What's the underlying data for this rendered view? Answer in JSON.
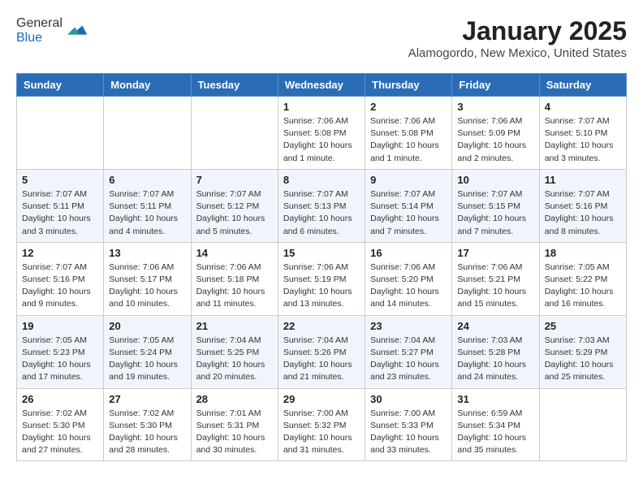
{
  "header": {
    "logo_line1": "General",
    "logo_line2": "Blue",
    "month": "January 2025",
    "location": "Alamogordo, New Mexico, United States"
  },
  "weekdays": [
    "Sunday",
    "Monday",
    "Tuesday",
    "Wednesday",
    "Thursday",
    "Friday",
    "Saturday"
  ],
  "weeks": [
    [
      {
        "day": "",
        "info": ""
      },
      {
        "day": "",
        "info": ""
      },
      {
        "day": "",
        "info": ""
      },
      {
        "day": "1",
        "info": "Sunrise: 7:06 AM\nSunset: 5:08 PM\nDaylight: 10 hours\nand 1 minute."
      },
      {
        "day": "2",
        "info": "Sunrise: 7:06 AM\nSunset: 5:08 PM\nDaylight: 10 hours\nand 1 minute."
      },
      {
        "day": "3",
        "info": "Sunrise: 7:06 AM\nSunset: 5:09 PM\nDaylight: 10 hours\nand 2 minutes."
      },
      {
        "day": "4",
        "info": "Sunrise: 7:07 AM\nSunset: 5:10 PM\nDaylight: 10 hours\nand 3 minutes."
      }
    ],
    [
      {
        "day": "5",
        "info": "Sunrise: 7:07 AM\nSunset: 5:11 PM\nDaylight: 10 hours\nand 3 minutes."
      },
      {
        "day": "6",
        "info": "Sunrise: 7:07 AM\nSunset: 5:11 PM\nDaylight: 10 hours\nand 4 minutes."
      },
      {
        "day": "7",
        "info": "Sunrise: 7:07 AM\nSunset: 5:12 PM\nDaylight: 10 hours\nand 5 minutes."
      },
      {
        "day": "8",
        "info": "Sunrise: 7:07 AM\nSunset: 5:13 PM\nDaylight: 10 hours\nand 6 minutes."
      },
      {
        "day": "9",
        "info": "Sunrise: 7:07 AM\nSunset: 5:14 PM\nDaylight: 10 hours\nand 7 minutes."
      },
      {
        "day": "10",
        "info": "Sunrise: 7:07 AM\nSunset: 5:15 PM\nDaylight: 10 hours\nand 7 minutes."
      },
      {
        "day": "11",
        "info": "Sunrise: 7:07 AM\nSunset: 5:16 PM\nDaylight: 10 hours\nand 8 minutes."
      }
    ],
    [
      {
        "day": "12",
        "info": "Sunrise: 7:07 AM\nSunset: 5:16 PM\nDaylight: 10 hours\nand 9 minutes."
      },
      {
        "day": "13",
        "info": "Sunrise: 7:06 AM\nSunset: 5:17 PM\nDaylight: 10 hours\nand 10 minutes."
      },
      {
        "day": "14",
        "info": "Sunrise: 7:06 AM\nSunset: 5:18 PM\nDaylight: 10 hours\nand 11 minutes."
      },
      {
        "day": "15",
        "info": "Sunrise: 7:06 AM\nSunset: 5:19 PM\nDaylight: 10 hours\nand 13 minutes."
      },
      {
        "day": "16",
        "info": "Sunrise: 7:06 AM\nSunset: 5:20 PM\nDaylight: 10 hours\nand 14 minutes."
      },
      {
        "day": "17",
        "info": "Sunrise: 7:06 AM\nSunset: 5:21 PM\nDaylight: 10 hours\nand 15 minutes."
      },
      {
        "day": "18",
        "info": "Sunrise: 7:05 AM\nSunset: 5:22 PM\nDaylight: 10 hours\nand 16 minutes."
      }
    ],
    [
      {
        "day": "19",
        "info": "Sunrise: 7:05 AM\nSunset: 5:23 PM\nDaylight: 10 hours\nand 17 minutes."
      },
      {
        "day": "20",
        "info": "Sunrise: 7:05 AM\nSunset: 5:24 PM\nDaylight: 10 hours\nand 19 minutes."
      },
      {
        "day": "21",
        "info": "Sunrise: 7:04 AM\nSunset: 5:25 PM\nDaylight: 10 hours\nand 20 minutes."
      },
      {
        "day": "22",
        "info": "Sunrise: 7:04 AM\nSunset: 5:26 PM\nDaylight: 10 hours\nand 21 minutes."
      },
      {
        "day": "23",
        "info": "Sunrise: 7:04 AM\nSunset: 5:27 PM\nDaylight: 10 hours\nand 23 minutes."
      },
      {
        "day": "24",
        "info": "Sunrise: 7:03 AM\nSunset: 5:28 PM\nDaylight: 10 hours\nand 24 minutes."
      },
      {
        "day": "25",
        "info": "Sunrise: 7:03 AM\nSunset: 5:29 PM\nDaylight: 10 hours\nand 25 minutes."
      }
    ],
    [
      {
        "day": "26",
        "info": "Sunrise: 7:02 AM\nSunset: 5:30 PM\nDaylight: 10 hours\nand 27 minutes."
      },
      {
        "day": "27",
        "info": "Sunrise: 7:02 AM\nSunset: 5:30 PM\nDaylight: 10 hours\nand 28 minutes."
      },
      {
        "day": "28",
        "info": "Sunrise: 7:01 AM\nSunset: 5:31 PM\nDaylight: 10 hours\nand 30 minutes."
      },
      {
        "day": "29",
        "info": "Sunrise: 7:00 AM\nSunset: 5:32 PM\nDaylight: 10 hours\nand 31 minutes."
      },
      {
        "day": "30",
        "info": "Sunrise: 7:00 AM\nSunset: 5:33 PM\nDaylight: 10 hours\nand 33 minutes."
      },
      {
        "day": "31",
        "info": "Sunrise: 6:59 AM\nSunset: 5:34 PM\nDaylight: 10 hours\nand 35 minutes."
      },
      {
        "day": "",
        "info": ""
      }
    ]
  ]
}
